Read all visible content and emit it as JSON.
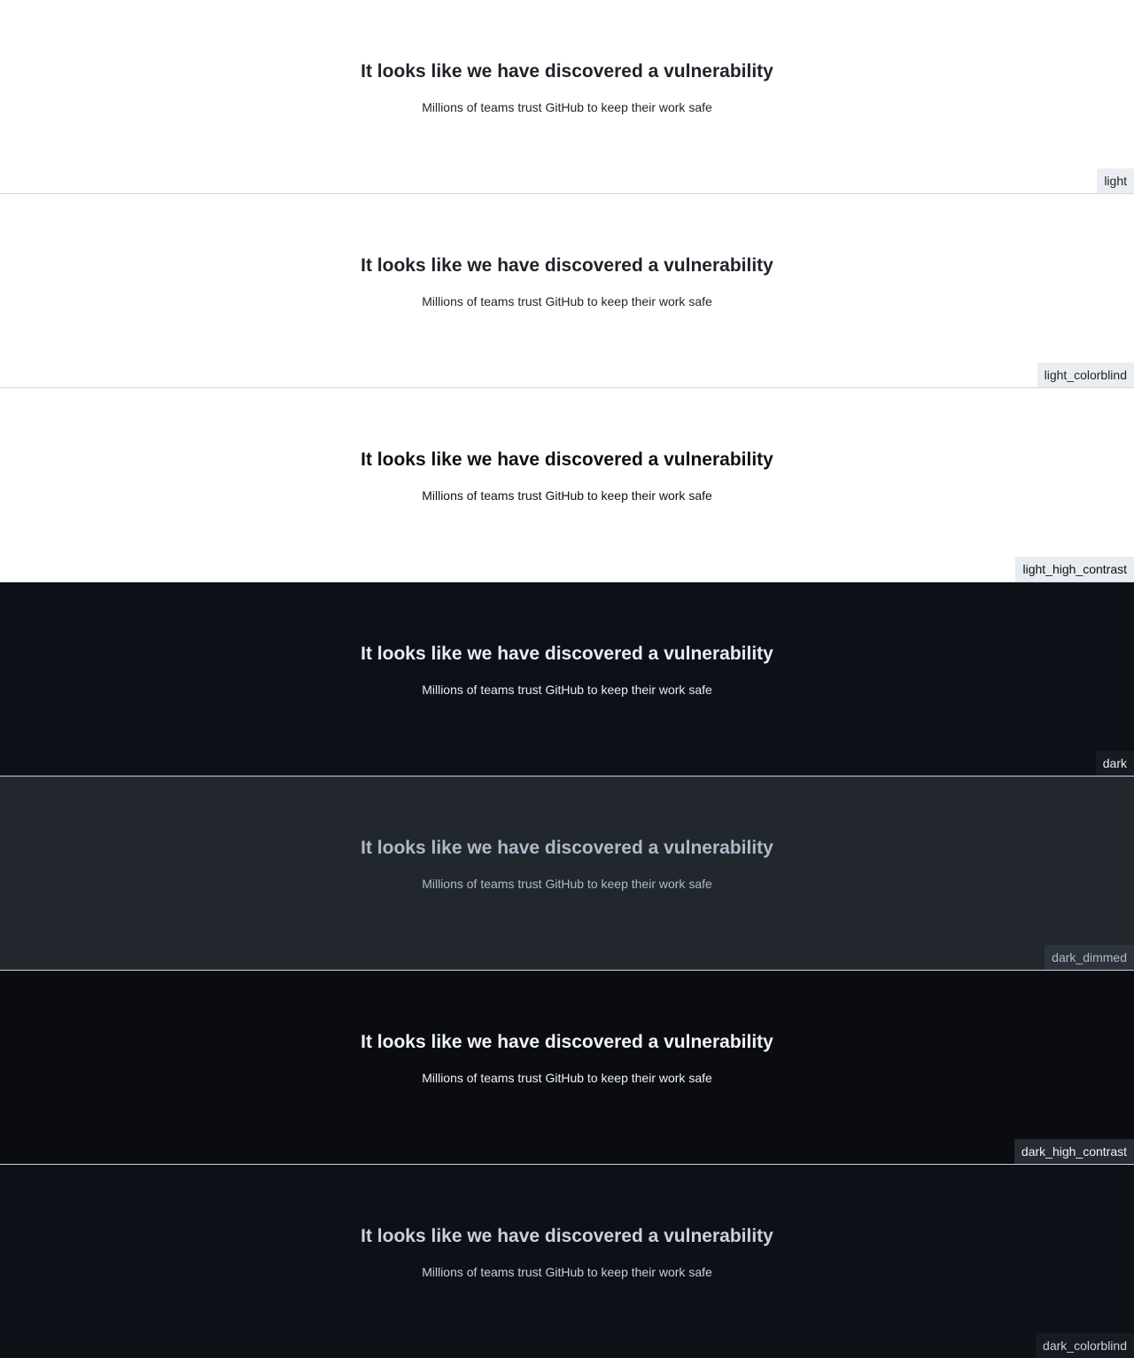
{
  "panels": [
    {
      "heading": "It looks like we have discovered a vulnerability",
      "subtext": "Millions of teams trust GitHub to keep their work safe",
      "theme": "light",
      "colors": {
        "bg": "#ffffff",
        "fg": "#1f2328",
        "tag_bg": "#eaeef2",
        "tag_fg": "#1f2328",
        "border": "#d0d7de"
      }
    },
    {
      "heading": "It looks like we have discovered a vulnerability",
      "subtext": "Millions of teams trust GitHub to keep their work safe",
      "theme": "light_colorblind",
      "colors": {
        "bg": "#ffffff",
        "fg": "#1f2328",
        "tag_bg": "#eaeef2",
        "tag_fg": "#1f2328",
        "border": "#d0d7de"
      }
    },
    {
      "heading": "It looks like we have discovered a vulnerability",
      "subtext": "Millions of teams trust GitHub to keep their work safe",
      "theme": "light_high_contrast",
      "colors": {
        "bg": "#ffffff",
        "fg": "#0e1116",
        "tag_bg": "#e7ecf0",
        "tag_fg": "#0e1116",
        "border": "#d0d7de"
      }
    },
    {
      "heading": "It looks like we have discovered a vulnerability",
      "subtext": "Millions of teams trust GitHub to keep their work safe",
      "theme": "dark",
      "colors": {
        "bg": "#0d1117",
        "fg": "#e6edf3",
        "tag_bg": "#161b22",
        "tag_fg": "#e6edf3",
        "border": "#c9d1d9"
      }
    },
    {
      "heading": "It looks like we have discovered a vulnerability",
      "subtext": "Millions of teams trust GitHub to keep their work safe",
      "theme": "dark_dimmed",
      "colors": {
        "bg": "#22272e",
        "fg": "#adbac7",
        "tag_bg": "#2d333b",
        "tag_fg": "#adbac7",
        "border": "#c9d1d9"
      }
    },
    {
      "heading": "It looks like we have discovered a vulnerability",
      "subtext": "Millions of teams trust GitHub to keep their work safe",
      "theme": "dark_high_contrast",
      "colors": {
        "bg": "#0a0c10",
        "fg": "#f0f3f6",
        "tag_bg": "#272b33",
        "tag_fg": "#f0f3f6",
        "border": "#c9d1d9"
      }
    },
    {
      "heading": "It looks like we have discovered a vulnerability",
      "subtext": "Millions of teams trust GitHub to keep their work safe",
      "theme": "dark_colorblind",
      "colors": {
        "bg": "#0d1117",
        "fg": "#c9d1d9",
        "tag_bg": "#161b22",
        "tag_fg": "#c9d1d9",
        "border": "#c9d1d9"
      }
    }
  ]
}
